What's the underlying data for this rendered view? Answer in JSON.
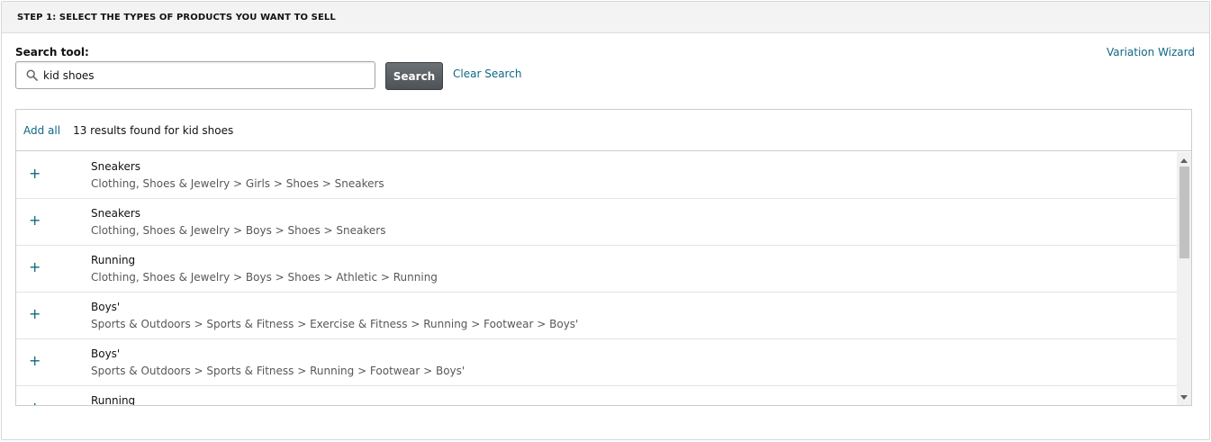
{
  "header": {
    "title": "STEP 1: SELECT THE TYPES OF PRODUCTS YOU WANT TO SELL"
  },
  "search": {
    "label": "Search tool:",
    "value": "kid shoes",
    "button_label": "Search",
    "clear_label": "Clear Search",
    "variation_wizard_label": "Variation Wizard"
  },
  "results": {
    "add_all_label": "Add all",
    "summary": "13 results found for kid shoes",
    "add_symbol": "+",
    "items": [
      {
        "title": "Sneakers",
        "path": "Clothing, Shoes & Jewelry > Girls > Shoes > Sneakers"
      },
      {
        "title": "Sneakers",
        "path": "Clothing, Shoes & Jewelry > Boys > Shoes > Sneakers"
      },
      {
        "title": "Running",
        "path": "Clothing, Shoes & Jewelry > Boys > Shoes > Athletic > Running"
      },
      {
        "title": "Boys'",
        "path": "Sports & Outdoors > Sports & Fitness > Exercise & Fitness > Running > Footwear > Boys'"
      },
      {
        "title": "Boys'",
        "path": "Sports & Outdoors > Sports & Fitness > Running > Footwear > Boys'"
      },
      {
        "title": "Running",
        "path": ""
      }
    ]
  },
  "icons": {
    "search": "search-icon",
    "add": "plus-icon",
    "scroll_up": "scroll-up-arrow-icon",
    "scroll_down": "scroll-down-arrow-icon"
  },
  "colors": {
    "link": "#0f6884",
    "button": "#55595d",
    "header_bg": "#f3f3f3"
  }
}
